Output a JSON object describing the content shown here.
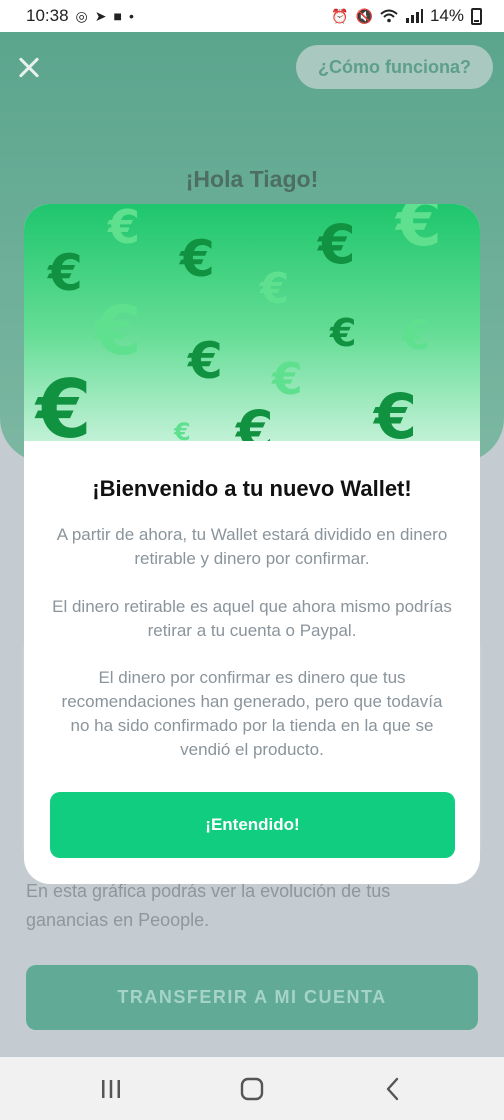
{
  "status_bar": {
    "time": "10:38",
    "battery": "14%"
  },
  "background": {
    "how_it_works": "¿Cómo funciona?",
    "greeting": "¡Hola Tiago!",
    "chart_text": "En esta gráfica podrás ver la evolución de tus ganancias en Peoople.",
    "transfer_button": "TRANSFERIR A MI CUENTA"
  },
  "modal": {
    "art_symbol": "€",
    "title": "¡Bienvenido a tu nuevo Wallet!",
    "paragraphs": [
      "A partir de ahora, tu Wallet estará dividido en dinero retirable y dinero por confirmar.",
      "El dinero retirable es aquel que ahora mismo podrías retirar a tu cuenta o Paypal.",
      "El dinero por confirmar es dinero que tus recomendaciones han generado, pero que todavía no ha sido confirmado por la tienda en la que se vendió el producto."
    ],
    "ok_button": "¡Entendido!"
  },
  "colors": {
    "accent": "#10cd80",
    "header_green": "#5ba58d",
    "euro_dark": "#109240",
    "euro_light": "#5fe08f"
  },
  "icons": [
    "close-icon",
    "recents-icon",
    "home-icon",
    "back-icon"
  ]
}
